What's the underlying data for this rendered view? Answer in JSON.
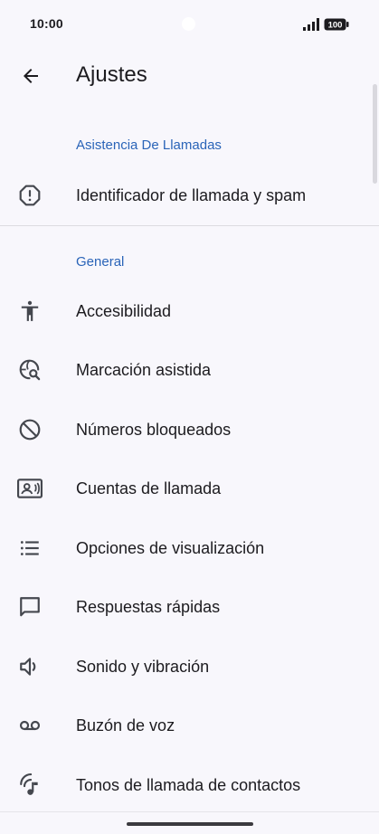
{
  "status_bar": {
    "time": "10:00",
    "battery": "100"
  },
  "header": {
    "title": "Ajustes"
  },
  "sections": [
    {
      "header": "Asistencia De Llamadas",
      "items": [
        {
          "label": "Identificador de llamada y spam",
          "icon": "alert-octagon-icon"
        }
      ]
    },
    {
      "header": "General",
      "items": [
        {
          "label": "Accesibilidad",
          "icon": "accessibility-icon"
        },
        {
          "label": "Marcación asistida",
          "icon": "globe-search-icon"
        },
        {
          "label": "Números bloqueados",
          "icon": "block-icon"
        },
        {
          "label": "Cuentas de llamada",
          "icon": "contact-card-icon"
        },
        {
          "label": "Opciones de visualización",
          "icon": "list-icon"
        },
        {
          "label": "Respuestas rápidas",
          "icon": "chat-bubble-icon"
        },
        {
          "label": "Sonido y vibración",
          "icon": "volume-icon"
        },
        {
          "label": "Buzón de voz",
          "icon": "voicemail-icon"
        },
        {
          "label": "Tonos de llamada de contactos",
          "icon": "ringtone-icon"
        }
      ]
    }
  ],
  "colors": {
    "accent": "#2a64b8",
    "background": "#f8f7fc",
    "text": "#1c1b1f",
    "icon": "#44474e"
  }
}
